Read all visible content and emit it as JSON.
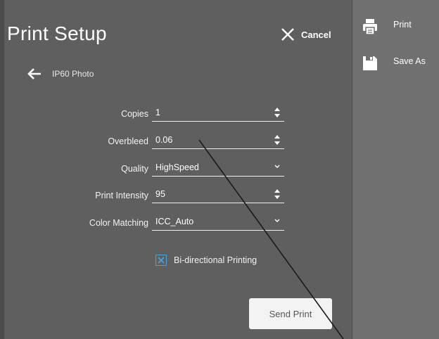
{
  "dialog": {
    "title": "Print Setup",
    "cancel_label": "Cancel",
    "back_label": "IP60 Photo",
    "fields": [
      {
        "label": "Copies",
        "value": "1",
        "control": "spin"
      },
      {
        "label": "Overbleed",
        "value": "0.06",
        "control": "spin"
      },
      {
        "label": "Quality",
        "value": "HighSpeed",
        "control": "dropdown"
      },
      {
        "label": "Print Intensity",
        "value": "95",
        "control": "spin"
      },
      {
        "label": "Color Matching",
        "value": "ICC_Auto",
        "control": "dropdown"
      }
    ],
    "bidirectional": {
      "label": "Bi-directional Printing",
      "checked": true
    },
    "send_label": "Send Print"
  },
  "sidebar": {
    "items": [
      {
        "label": "Print",
        "icon": "printer-icon"
      },
      {
        "label": "Save As",
        "icon": "save-icon"
      }
    ]
  },
  "colors": {
    "dialog_bg": "#5f5f5f",
    "sidebar_bg": "#707070",
    "checkbox_accent": "#4aa3df",
    "button_bg": "#f3f3f3"
  }
}
